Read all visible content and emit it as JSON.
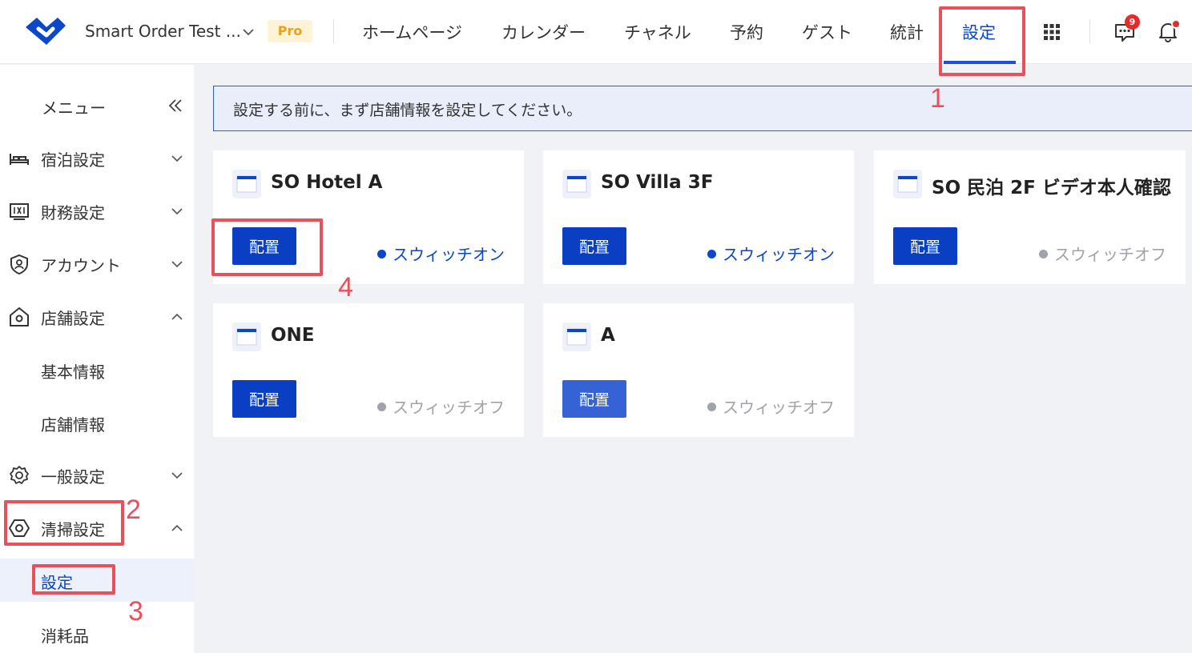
{
  "header": {
    "app_title": "Smart Order Test ...",
    "plan_badge": "Pro",
    "nav": [
      "ホームページ",
      "カレンダー",
      "チャネル",
      "予約",
      "ゲスト",
      "統計",
      "設定"
    ],
    "active_nav": "設定",
    "message_count": "9"
  },
  "sidebar": {
    "menu_title": "メニュー",
    "items": [
      {
        "label": "宿泊設定",
        "icon": "bed-icon",
        "expanded": false
      },
      {
        "label": "財務設定",
        "icon": "finance-icon",
        "expanded": false
      },
      {
        "label": "アカウント",
        "icon": "account-shield-icon",
        "expanded": false
      },
      {
        "label": "店舗設定",
        "icon": "store-icon",
        "expanded": true,
        "children": [
          "基本情報",
          "店舗情報"
        ]
      },
      {
        "label": "一般設定",
        "icon": "gear-icon",
        "expanded": false
      },
      {
        "label": "清掃設定",
        "icon": "cleaning-icon",
        "expanded": true,
        "children": [
          "設定",
          "消耗品"
        ]
      }
    ],
    "active_child": "設定"
  },
  "notice": "設定する前に、まず店舗情報を設定してください。",
  "cards": [
    {
      "title": "SO Hotel A",
      "button": "配置",
      "status": "スウィッチオン",
      "on": true
    },
    {
      "title": "SO Villa 3F",
      "button": "配置",
      "status": "スウィッチオン",
      "on": true
    },
    {
      "title": "SO 民泊 2F ビデオ本人確認",
      "button": "配置",
      "status": "スウィッチオフ",
      "on": false
    },
    {
      "title": "ONE",
      "button": "配置",
      "status": "スウィッチオフ",
      "on": false
    },
    {
      "title": "A",
      "button": "配置",
      "status": "スウィッチオフ",
      "on": false
    }
  ],
  "annotations": [
    "1",
    "2",
    "3",
    "4"
  ],
  "colors": {
    "primary": "#0a3fc4",
    "accent_text": "#0a47c9",
    "annotation": "#e8505b",
    "status_off": "#a0a3aa",
    "background": "#f1f2f6"
  }
}
